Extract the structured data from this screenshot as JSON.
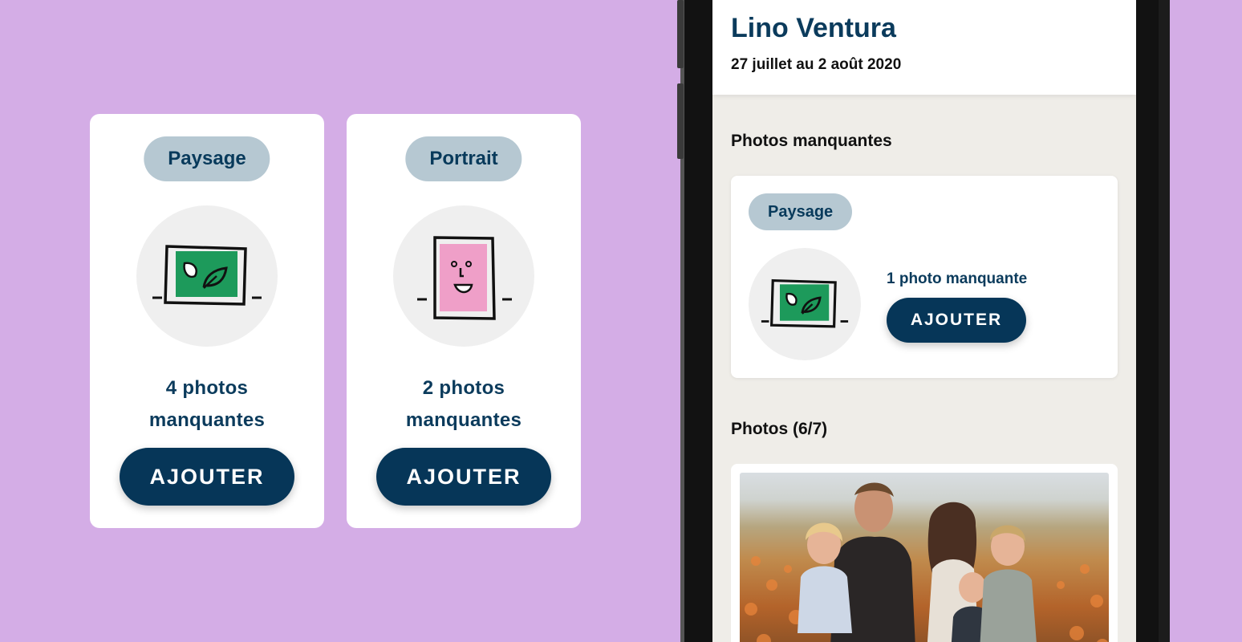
{
  "cards": [
    {
      "tag": "Paysage",
      "count_line1": "4 photos",
      "count_line2": "manquantes",
      "button": "AJOUTER",
      "icon": "landscape-frame-icon"
    },
    {
      "tag": "Portrait",
      "count_line1": "2 photos",
      "count_line2": "manquantes",
      "button": "AJOUTER",
      "icon": "portrait-frame-icon"
    }
  ],
  "phone": {
    "title": "Lino Ventura",
    "dates": "27 juillet au 2 août 2020",
    "missing_section": "Photos manquantes",
    "missing_card": {
      "tag": "Paysage",
      "count": "1 photo manquante",
      "button": "AJOUTER",
      "icon": "landscape-frame-icon"
    },
    "photos_section": "Photos (6/7)"
  },
  "colors": {
    "background": "#d4ade6",
    "navy": "#063658",
    "tag_bg": "#b6c8d2",
    "green": "#1d9a5b",
    "pink": "#ef9fc8"
  }
}
